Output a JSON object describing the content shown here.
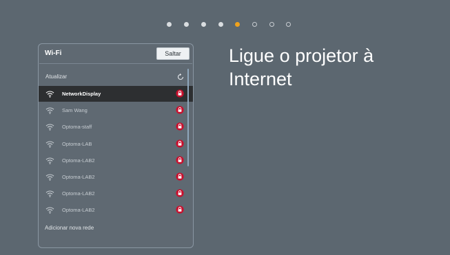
{
  "pagination": {
    "total": 8,
    "current_step": 5
  },
  "wifi_panel": {
    "title": "Wi-Fi",
    "skip_label": "Saltar",
    "refresh_label": "Atualizar",
    "refresh_icon": "refresh-icon",
    "add_network_label": "Adicionar nova rede",
    "networks": [
      {
        "name": "NetworkDisplay",
        "selected": true,
        "secured": true
      },
      {
        "name": "Sam Wang",
        "selected": false,
        "secured": true
      },
      {
        "name": "Optoma-staff",
        "selected": false,
        "secured": true
      },
      {
        "name": "Optoma-LAB",
        "selected": false,
        "secured": true
      },
      {
        "name": "Optoma-LAB2",
        "selected": false,
        "secured": true
      },
      {
        "name": "Optoma-LAB2",
        "selected": false,
        "secured": true
      },
      {
        "name": "Optoma-LAB2",
        "selected": false,
        "secured": true
      },
      {
        "name": "Optoma-LAB2",
        "selected": false,
        "secured": true
      }
    ]
  },
  "heading": "Ligue o projetor à Internet",
  "colors": {
    "background": "#5c6770",
    "active_dot": "#f0a21c",
    "lock": "#c8102e",
    "selected_row": "#2d2f31"
  }
}
